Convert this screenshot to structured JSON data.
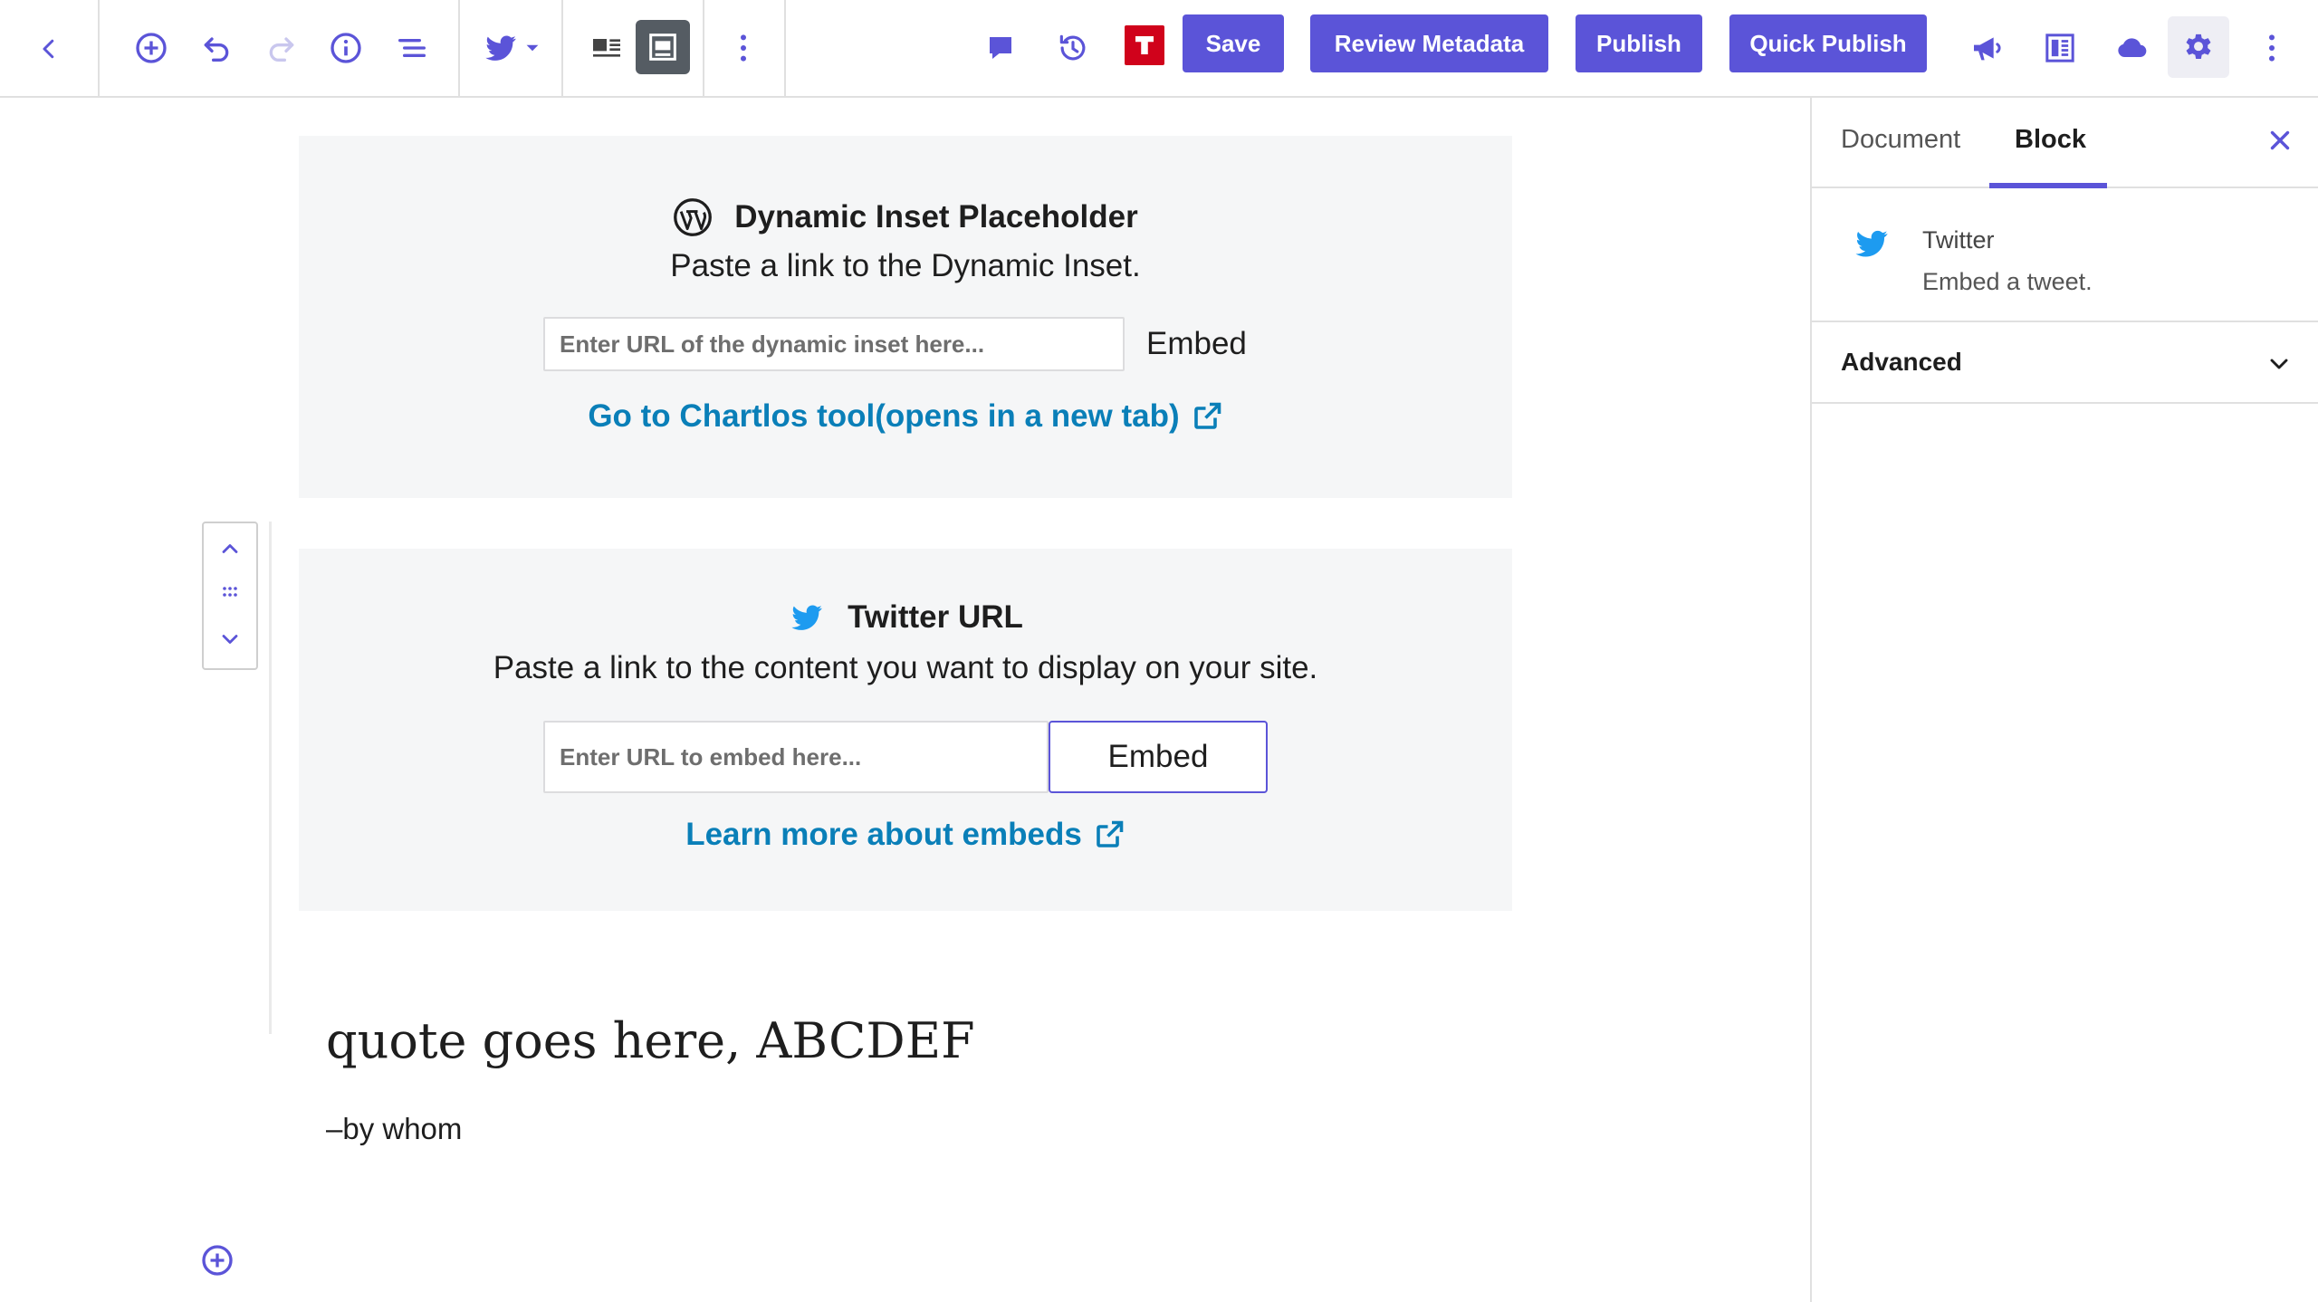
{
  "toolbar": {
    "save_label": "Save",
    "review_metadata_label": "Review Metadata",
    "publish_label": "Publish",
    "quick_publish_label": "Quick Publish"
  },
  "blocks": {
    "dynamic_inset": {
      "title": "Dynamic Inset Placeholder",
      "instructions": "Paste a link to the Dynamic Inset.",
      "input_placeholder": "Enter URL of the dynamic inset here...",
      "embed_label": "Embed",
      "link_label": "Go to Chartlos tool(opens in a new tab)"
    },
    "twitter": {
      "title": "Twitter URL",
      "instructions": "Paste a link to the content you want to display on your site.",
      "input_placeholder": "Enter URL to embed here...",
      "embed_label": "Embed",
      "link_label": "Learn more about embeds"
    },
    "quote": {
      "text": "quote goes here, ABCDEF",
      "citation": "–by whom"
    }
  },
  "sidebar": {
    "tabs": [
      {
        "label": "Document",
        "active": false
      },
      {
        "label": "Block",
        "active": true
      }
    ],
    "block_card": {
      "title": "Twitter",
      "description": "Embed a tweet."
    },
    "advanced_label": "Advanced"
  },
  "colors": {
    "accent": "#5b54d8",
    "link": "#0a7fb8",
    "twitter_blue": "#1d9bf0",
    "brand_red": "#d0021b",
    "block_bg": "#f5f6f7"
  }
}
